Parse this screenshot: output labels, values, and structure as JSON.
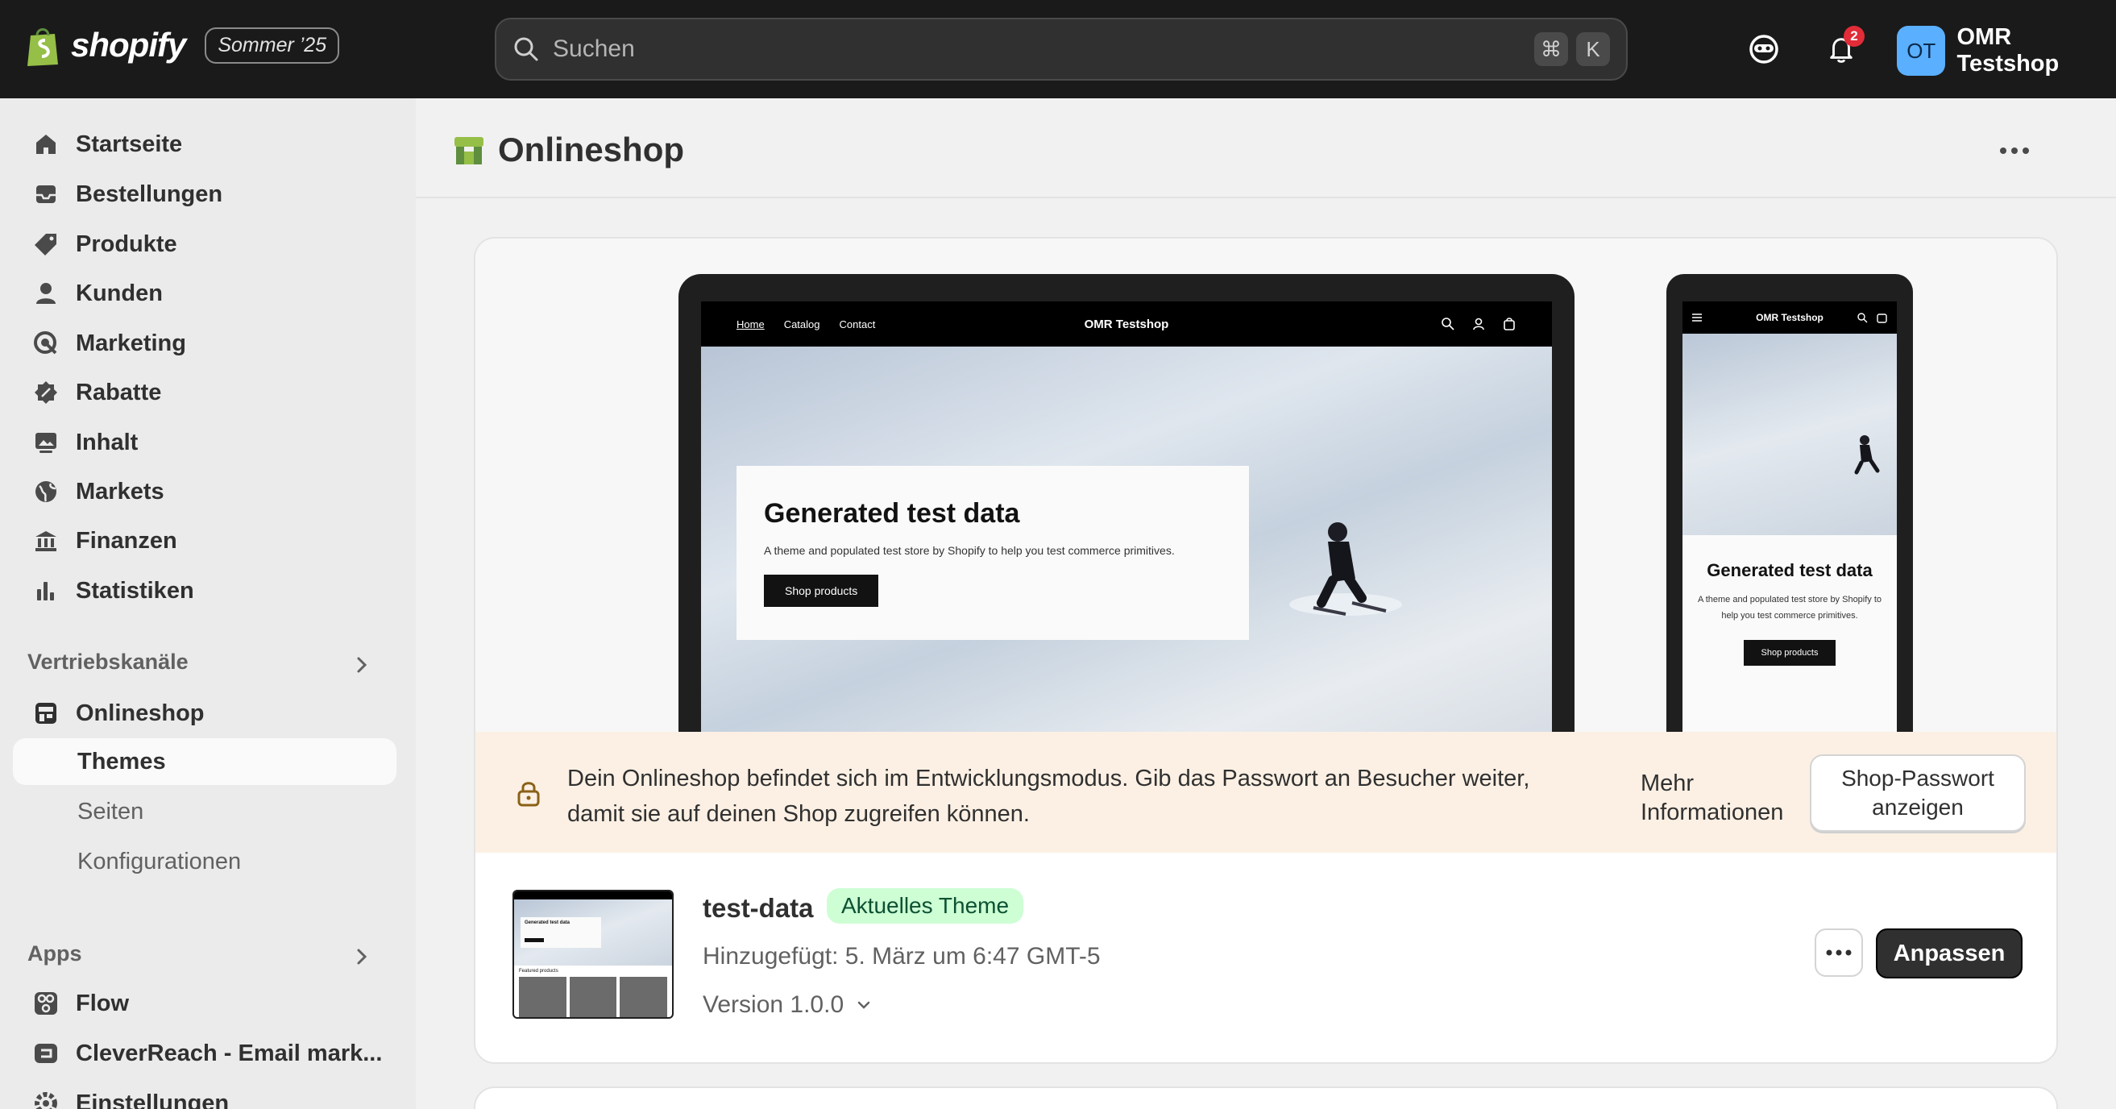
{
  "topbar": {
    "brand": "shopify",
    "edition": "Sommer ’25",
    "search_placeholder": "Suchen",
    "shortcut_cmd": "⌘",
    "shortcut_key": "K",
    "notifications_count": "2",
    "user_initials": "OT",
    "user_name": "OMR Testshop"
  },
  "sidebar": {
    "items": [
      {
        "label": "Startseite",
        "icon": "home-icon"
      },
      {
        "label": "Bestellungen",
        "icon": "inbox-icon"
      },
      {
        "label": "Produkte",
        "icon": "tag-icon"
      },
      {
        "label": "Kunden",
        "icon": "person-icon"
      },
      {
        "label": "Marketing",
        "icon": "target-icon"
      },
      {
        "label": "Rabatte",
        "icon": "discount-icon"
      },
      {
        "label": "Inhalt",
        "icon": "image-icon"
      },
      {
        "label": "Markets",
        "icon": "globe-icon"
      },
      {
        "label": "Finanzen",
        "icon": "bank-icon"
      },
      {
        "label": "Statistiken",
        "icon": "bar-chart-icon"
      }
    ],
    "channels_heading": "Vertriebskanäle",
    "onlineshop": "Onlineshop",
    "sub_items": [
      "Themes",
      "Seiten",
      "Konfigurationen"
    ],
    "apps_heading": "Apps",
    "apps": [
      "Flow",
      "CleverReach - Email mark..."
    ],
    "settings": "Einstellungen"
  },
  "main": {
    "title": "Onlineshop",
    "preview": {
      "nav_links": [
        "Home",
        "Catalog",
        "Contact"
      ],
      "store_name": "OMR Testshop",
      "hero_title": "Generated test data",
      "hero_text": "A theme and populated test store by Shopify to help you test commerce primitives.",
      "hero_button": "Shop products",
      "mobile_hero_title": "Generated test data",
      "mobile_hero_text": "A theme and populated test store by Shopify to help you test commerce primitives.",
      "mobile_button": "Shop products",
      "thumb_title": "Generated test data",
      "thumb_section": "Featured products"
    },
    "banner": {
      "text": "Dein Onlineshop befindet sich im Entwicklungsmodus. Gib das Passwort an Besucher weiter, damit sie auf deinen Shop zugreifen können.",
      "more": "Mehr Informationen",
      "password_button": "Shop-Passwort anzeigen"
    },
    "theme": {
      "name": "test-data",
      "badge": "Aktuelles Theme",
      "added": "Hinzugefügt: 5. März um 6:47 GMT-5",
      "version": "Version 1.0.0",
      "customize": "Anpassen"
    }
  },
  "colors": {
    "topbar": "#1a1a1a",
    "sidebar": "#ebebeb",
    "badge_bg": "#cdfed4",
    "banner_bg": "#fcf0e4",
    "avatar_bg": "#5aafff",
    "notif_red": "#e22c38"
  }
}
